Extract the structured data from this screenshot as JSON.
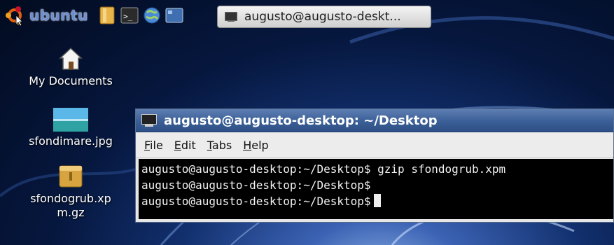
{
  "panel": {
    "logo_text": "ubuntu",
    "launchers": [
      "file-manager-icon",
      "terminal-icon",
      "web-browser-icon",
      "show-desktop-icon"
    ],
    "task": {
      "label": "augusto@augusto-deskt..."
    }
  },
  "desktop_icons": [
    {
      "label": "My Documents",
      "icon": "home-folder-icon"
    },
    {
      "label": "sfondimare.jpg",
      "icon": "image-file-icon"
    },
    {
      "label": "sfondogrub.xp",
      "label2": "m.gz",
      "icon": "archive-file-icon"
    }
  ],
  "terminal": {
    "title": "augusto@augusto-desktop: ~/Desktop",
    "menu": [
      {
        "key": "F",
        "rest": "ile"
      },
      {
        "key": "E",
        "rest": "dit"
      },
      {
        "key": "T",
        "rest": "abs"
      },
      {
        "key": "H",
        "rest": "elp"
      }
    ],
    "lines": [
      "augusto@augusto-desktop:~/Desktop$ gzip sfondogrub.xpm",
      "augusto@augusto-desktop:~/Desktop$",
      "augusto@augusto-desktop:~/Desktop$"
    ]
  },
  "colors": {
    "title_bar": "#3a5e96",
    "terminal_bg": "#000000",
    "wallpaper": "#06173e"
  }
}
